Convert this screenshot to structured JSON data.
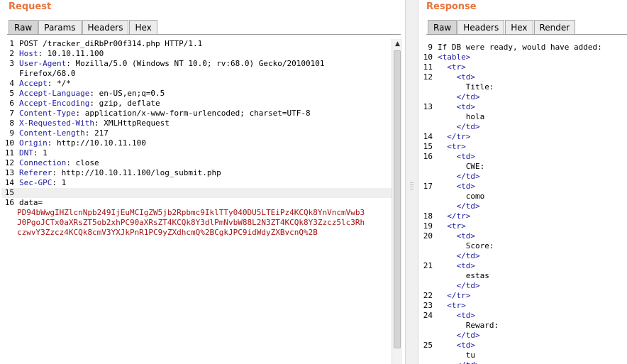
{
  "request": {
    "title": "Request",
    "tabs": [
      {
        "label": "Raw"
      },
      {
        "label": "Params"
      },
      {
        "label": "Headers"
      },
      {
        "label": "Hex"
      }
    ],
    "lines": [
      {
        "num": "1",
        "key": "",
        "rest": "POST /tracker_diRbPr00f314.php HTTP/1.1"
      },
      {
        "num": "2",
        "key": "Host",
        "rest": ": 10.10.11.100"
      },
      {
        "num": "3",
        "key": "User-Agent",
        "rest": ": Mozilla/5.0 (Windows NT 10.0; rv:68.0) Gecko/20100101",
        "cont": "Firefox/68.0"
      },
      {
        "num": "4",
        "key": "Accept",
        "rest": ": */*"
      },
      {
        "num": "5",
        "key": "Accept-Language",
        "rest": ": en-US,en;q=0.5"
      },
      {
        "num": "6",
        "key": "Accept-Encoding",
        "rest": ": gzip, deflate"
      },
      {
        "num": "7",
        "key": "Content-Type",
        "rest": ": application/x-www-form-urlencoded; charset=UTF-8"
      },
      {
        "num": "8",
        "key": "X-Requested-With",
        "rest": ": XMLHttpRequest"
      },
      {
        "num": "9",
        "key": "Content-Length",
        "rest": ": 217"
      },
      {
        "num": "10",
        "key": "Origin",
        "rest": ": http://10.10.11.100"
      },
      {
        "num": "11",
        "key": "DNT",
        "rest": ": 1"
      },
      {
        "num": "12",
        "key": "Connection",
        "rest": ": close"
      },
      {
        "num": "13",
        "key": "Referer",
        "rest": ": http://10.10.11.100/log_submit.php"
      },
      {
        "num": "14",
        "key": "Sec-GPC",
        "rest": ": 1"
      },
      {
        "num": "15",
        "key": "",
        "rest": ""
      },
      {
        "num": "16",
        "key": "",
        "rest": "data="
      }
    ],
    "data_value_lines": [
      "PD94bWwgIHZlcnNpb249IjEuMCIgZW5jb2Rpbmc9IklTTy040DU5LTEiPz4KCQk8YnVncmVwb3",
      "J0PgoJCTx0aXRsZT5ob2xhPC90aXRsZT4KCQk8Y3dlPmNvbW88L2N3ZT4KCQk8Y3Zzcz5lc3Rh",
      "czwvY3Zzcz4KCQk8cmV3YXJkPnR1PC9yZXdhcmQ%2BCgkJPC9idWdyZXBvcnQ%2B"
    ]
  },
  "response": {
    "title": "Response",
    "tabs": [
      {
        "label": "Raw"
      },
      {
        "label": "Headers"
      },
      {
        "label": "Hex"
      },
      {
        "label": "Render"
      }
    ],
    "lines": [
      {
        "num": "9",
        "text": "If DB were ready, would have added:",
        "tag": false
      },
      {
        "num": "10",
        "text": "<table>",
        "tag": true
      },
      {
        "num": "11",
        "text": "  <tr>",
        "tag": true
      },
      {
        "num": "12",
        "text": "    <td>",
        "tag": true,
        "cont": [
          "      Title:",
          "    </td>"
        ]
      },
      {
        "num": "13",
        "text": "    <td>",
        "tag": true,
        "cont": [
          "      hola",
          "    </td>"
        ]
      },
      {
        "num": "14",
        "text": "  </tr>",
        "tag": true
      },
      {
        "num": "15",
        "text": "  <tr>",
        "tag": true
      },
      {
        "num": "16",
        "text": "    <td>",
        "tag": true,
        "cont": [
          "      CWE:",
          "    </td>"
        ]
      },
      {
        "num": "17",
        "text": "    <td>",
        "tag": true,
        "cont": [
          "      como",
          "    </td>"
        ]
      },
      {
        "num": "18",
        "text": "  </tr>",
        "tag": true
      },
      {
        "num": "19",
        "text": "  <tr>",
        "tag": true
      },
      {
        "num": "20",
        "text": "    <td>",
        "tag": true,
        "cont": [
          "      Score:",
          "    </td>"
        ]
      },
      {
        "num": "21",
        "text": "    <td>",
        "tag": true,
        "cont": [
          "      estas",
          "    </td>"
        ]
      },
      {
        "num": "22",
        "text": "  </tr>",
        "tag": true
      },
      {
        "num": "23",
        "text": "  <tr>",
        "tag": true
      },
      {
        "num": "24",
        "text": "    <td>",
        "tag": true,
        "cont": [
          "      Reward:",
          "    </td>"
        ]
      },
      {
        "num": "25",
        "text": "    <td>",
        "tag": true,
        "cont": [
          "      tu",
          "    </td>"
        ]
      }
    ]
  },
  "colors": {
    "title": "#e8743b",
    "header_key": "#1e1ea0",
    "data_value": "#a31515",
    "tag": "#1e1ea0",
    "active_line": "#efefef"
  }
}
